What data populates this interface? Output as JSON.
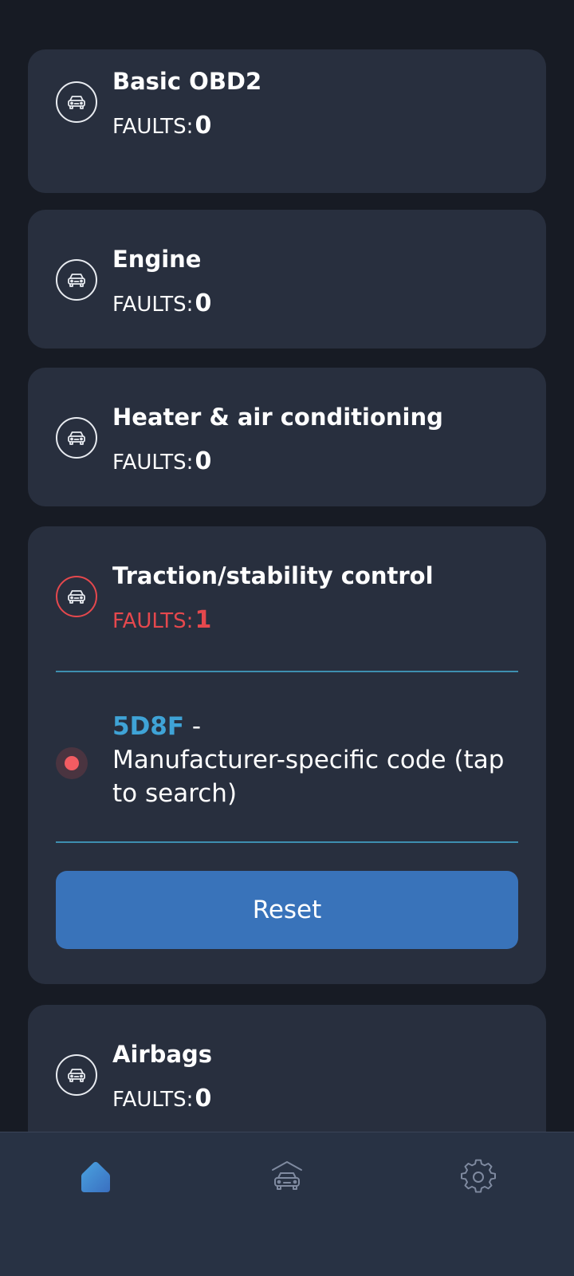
{
  "systems": [
    {
      "title": "Basic OBD2",
      "faults_label": "FAULTS:",
      "faults_count": "0"
    },
    {
      "title": "Engine",
      "faults_label": "FAULTS:",
      "faults_count": "0"
    },
    {
      "title": "Heater & air conditioning",
      "faults_label": "FAULTS:",
      "faults_count": "0"
    },
    {
      "title": "Traction/stability control",
      "faults_label": "FAULTS:",
      "faults_count": "1",
      "fault_code": {
        "code": "5D8F",
        "separator": " -",
        "description": "Manufacturer-specific code (tap to search)"
      },
      "reset_label": "Reset"
    },
    {
      "title": "Airbags",
      "faults_label": "FAULTS:",
      "faults_count": "0"
    }
  ],
  "bottom_nav": {
    "items": [
      {
        "icon": "home-icon",
        "active": true
      },
      {
        "icon": "car-garage-icon",
        "active": false
      },
      {
        "icon": "gear-icon",
        "active": false
      }
    ]
  },
  "colors": {
    "background": "#171b24",
    "card": "#282f3e",
    "fault_red": "#e5484d",
    "code_blue": "#3fa3d6",
    "button_blue": "#3973ba",
    "divider": "#3e8fb0"
  }
}
